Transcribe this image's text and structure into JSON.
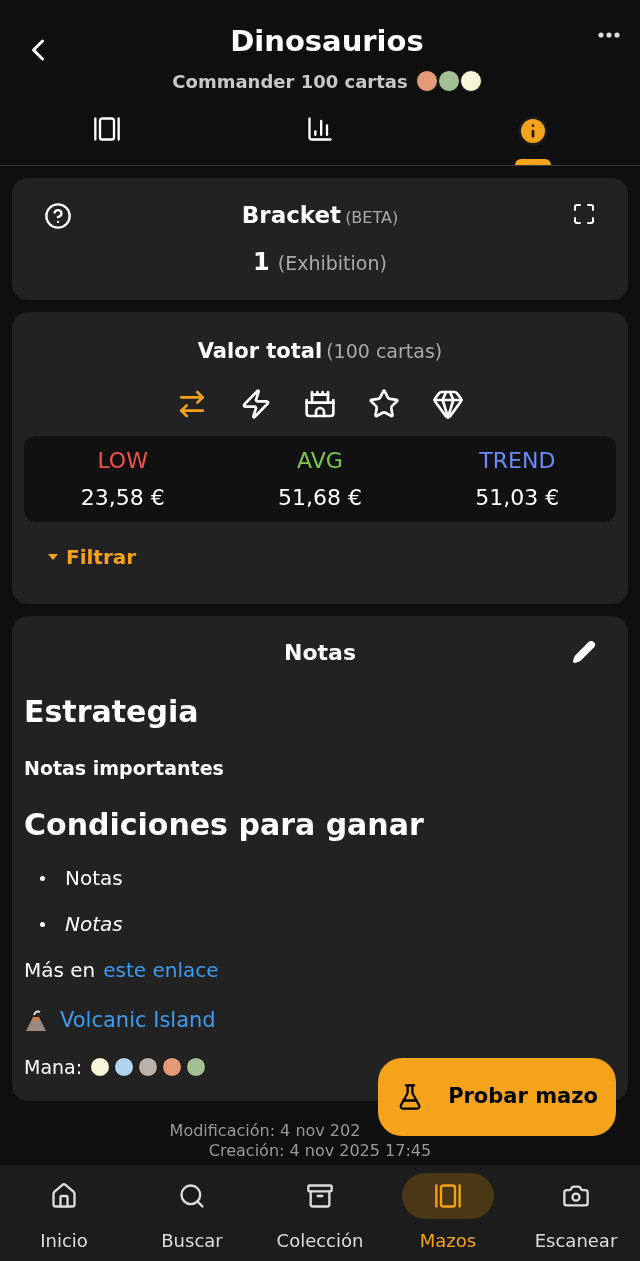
{
  "header": {
    "title": "Dinosaurios",
    "subtitle": "Commander 100 cartas",
    "colors": [
      {
        "color": "#e49977"
      },
      {
        "color": "#a3c095"
      },
      {
        "color": "#f8f6d8"
      }
    ]
  },
  "tabs": [
    {
      "kind": "cards",
      "selected": false
    },
    {
      "kind": "stats",
      "selected": false
    },
    {
      "kind": "info",
      "selected": true
    }
  ],
  "bracket": {
    "title": "Bracket",
    "tag": "(BETA)",
    "value": "1",
    "label": "(Exhibition)"
  },
  "value": {
    "title": "Valor total",
    "count": "(100 cartas)",
    "sources": [
      {
        "kind": "trade",
        "selected": true
      },
      {
        "kind": "cards",
        "selected": false
      },
      {
        "kind": "castle",
        "selected": false
      },
      {
        "kind": "star",
        "selected": false
      },
      {
        "kind": "crystal",
        "selected": false
      }
    ],
    "prices": [
      {
        "label": "LOW",
        "amount": "23,58 €",
        "color": "#ef5350"
      },
      {
        "label": "AVG",
        "amount": "51,68 €",
        "color": "#7cc84a"
      },
      {
        "label": "TREND",
        "amount": "51,03 €",
        "color": "#6b8cff"
      }
    ],
    "filter": "Filtrar"
  },
  "notes": {
    "title": "Notas",
    "heading1": "Estrategia",
    "bold_line": "Notas importantes",
    "heading2": "Condiciones para ganar",
    "bullets": [
      {
        "text": "Notas",
        "italic": false
      },
      {
        "text": "Notas",
        "italic": true
      }
    ],
    "more_text": "Más en",
    "more_link": "este enlace",
    "card_link": "Volcanic Island",
    "mana_label": "Mana:",
    "mana": [
      {
        "color": "#f8f6d8"
      },
      {
        "color": "#b3d4ef"
      },
      {
        "color": "#bab1ab"
      },
      {
        "color": "#e49977"
      },
      {
        "color": "#a3c095"
      }
    ]
  },
  "modified": "Modificación: 4 nov 202",
  "created": "Creación: 4 nov 2025 17:45",
  "fab": "Probar mazo",
  "nav": [
    {
      "kind": "home",
      "label": "Inicio",
      "selected": false
    },
    {
      "kind": "search",
      "label": "Buscar",
      "selected": false
    },
    {
      "kind": "collection",
      "label": "Colección",
      "selected": false
    },
    {
      "kind": "decks",
      "label": "Mazos",
      "selected": true
    },
    {
      "kind": "camera",
      "label": "Escanear",
      "selected": false
    }
  ]
}
